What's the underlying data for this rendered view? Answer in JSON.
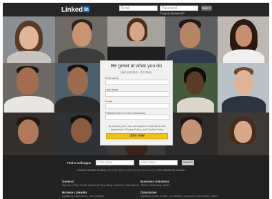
{
  "header": {
    "logo_text": "Linked",
    "logo_badge": "in",
    "email_placeholder": "Email",
    "password_placeholder": "Password",
    "signin_label": "Sign in",
    "forgot_label": "Forgot password?"
  },
  "signup": {
    "title": "Be great at what you do",
    "subtitle": "Get started - it's free.",
    "first_name_label": "First name",
    "last_name_label": "Last name",
    "email_label": "Email",
    "password_label": "Password (6 or more characters)",
    "terms_text": "By clicking Join now, you agree to LinkedIn's User Agreement, Privacy Policy, and Cookie Policy.",
    "join_label": "Join now"
  },
  "find": {
    "label": "Find a colleague",
    "first_placeholder": "First name",
    "last_placeholder": "Last name",
    "search_label": "Search",
    "directory_prefix": "LinkedIn member directory:",
    "directory_letters": "a b c d e f g h i j k l m n o p q r s t u v w x y z more",
    "directory_suffix": "Browse by country »"
  },
  "footer": {
    "general_title": "General",
    "general_links": "Sign Up | Help Center | About | Press | Blog | Careers | Developers",
    "business_title": "Business Solutions",
    "business_links": "Talent | Marketing | Sales",
    "browse_title": "Browse LinkedIn",
    "browse_links": "Updates | Influencers | Jobs | Mobile",
    "directories_title": "Directories",
    "directories_links": "Members | Jobs | Pulse | Companies | Groups | Universities | Titles"
  },
  "colors": {
    "page_bg": "#1f1f1f",
    "brand_blue": "#0a66c2",
    "join_yellow": "#f4c20d",
    "card_bg": "#f1f1f1"
  }
}
